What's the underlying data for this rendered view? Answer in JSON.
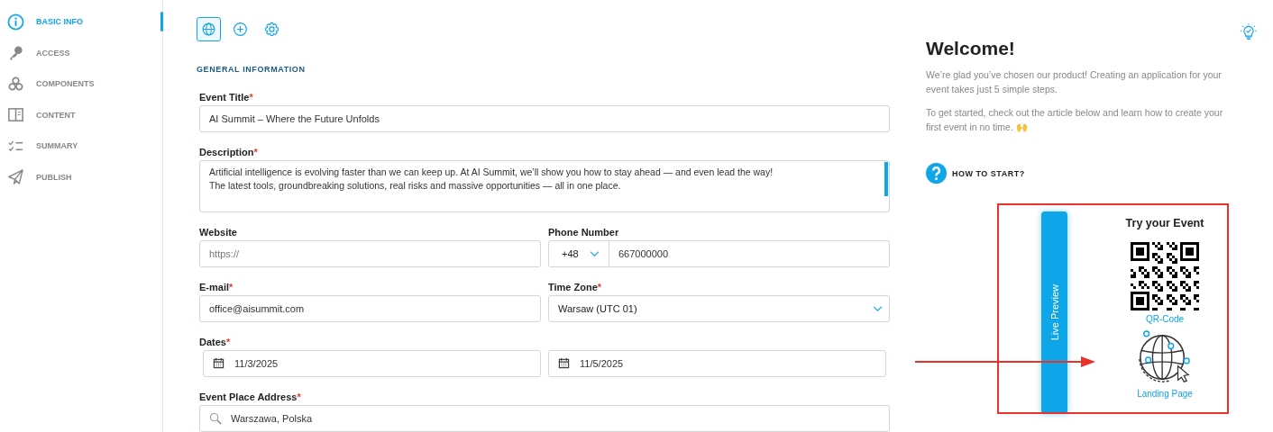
{
  "sidebar": {
    "items": [
      {
        "kind": "info",
        "label": "BASIC INFO",
        "selected": true
      },
      {
        "kind": "key",
        "label": "ACCESS",
        "selected": false
      },
      {
        "kind": "components",
        "label": "COMPONENTS",
        "selected": false
      },
      {
        "kind": "content",
        "label": "CONTENT",
        "selected": false
      },
      {
        "kind": "summary",
        "label": "SUMMARY",
        "selected": false
      },
      {
        "kind": "publish",
        "label": "PUBLISH",
        "selected": false
      }
    ]
  },
  "toolbar": {
    "items": [
      {
        "kind": "globe",
        "selected": true
      },
      {
        "kind": "add",
        "selected": false
      },
      {
        "kind": "settings",
        "selected": false
      }
    ]
  },
  "section_title": "GENERAL INFORMATION",
  "event_title": {
    "label": "Event Title",
    "required_mark": "*",
    "value": "AI Summit – Where the Future Unfolds"
  },
  "description": {
    "label": "Description",
    "required_mark": "*",
    "lines": [
      "Artificial intelligence is evolving faster than we can keep up. At AI Summit, we’ll show you how to stay ahead — and even lead the way!",
      "The latest tools, groundbreaking solutions, real risks and massive opportunities — all in one place."
    ]
  },
  "website": {
    "label": "Website",
    "placeholder": "https://"
  },
  "phone": {
    "label": "Phone Number",
    "country_code": "+48",
    "value": "667000000"
  },
  "email": {
    "label": "E-mail",
    "required_mark": "*",
    "value": "office@aisummit.com"
  },
  "time_zone": {
    "label": "Time Zone",
    "required_mark": "*",
    "value": "Warsaw (UTC 01)"
  },
  "dates": {
    "label": "Dates",
    "required_mark": "*",
    "start": "11/3/2025",
    "end": "11/5/2025"
  },
  "address": {
    "label": "Event Place Address",
    "required_mark": "*",
    "value": "Warszawa, Polska"
  },
  "welcome": {
    "title": "Welcome!",
    "paragraphs": [
      "We’re glad you’ve chosen our product! Creating an application for your event takes just 5 simple steps.",
      "To get started, check out the article below and learn how to create your first event in no time. 🙌"
    ],
    "help_link": "HOW TO START?"
  },
  "preview": {
    "tab": "Live Preview",
    "title": "Try your Event",
    "options": [
      {
        "kind": "qr",
        "label": "QR-Code"
      },
      {
        "kind": "landing",
        "label": "Landing Page"
      }
    ]
  }
}
